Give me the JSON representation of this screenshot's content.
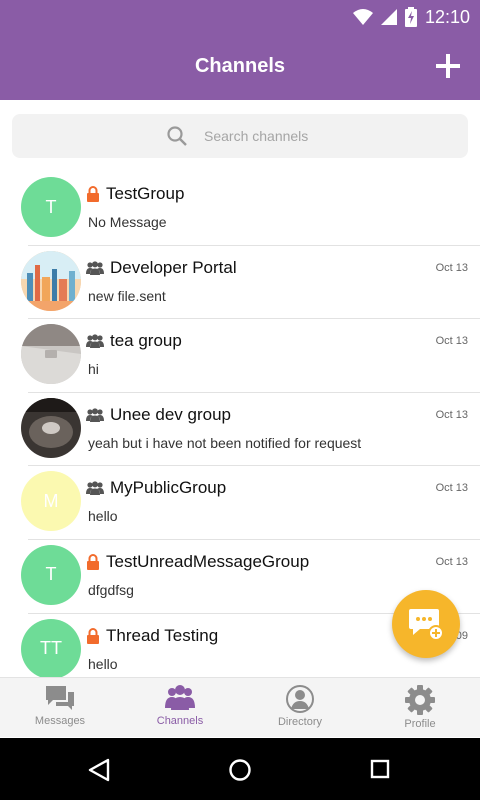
{
  "status_bar": {
    "time": "12:10"
  },
  "header": {
    "title": "Channels",
    "add_icon": "plus-icon"
  },
  "search": {
    "placeholder": "Search channels",
    "icon": "search-icon"
  },
  "colors": {
    "primary": "#8a5ca6",
    "avatar_green": "#6edc97",
    "avatar_yellow": "#fbf9b0",
    "lock_orange": "#f26b2c",
    "fab": "#f6b62b"
  },
  "channels": [
    {
      "avatar_text": "T",
      "avatar_type": "letter",
      "privacy": "private",
      "name": "TestGroup",
      "message": "No Message",
      "date": ""
    },
    {
      "avatar_text": "",
      "avatar_type": "photo-city",
      "privacy": "public",
      "name": "Developer Portal",
      "message": "new file.sent",
      "date": "Oct 13"
    },
    {
      "avatar_text": "",
      "avatar_type": "photo-desk",
      "privacy": "public",
      "name": "tea group",
      "message": "hi",
      "date": "Oct 13"
    },
    {
      "avatar_text": "",
      "avatar_type": "photo-dark",
      "privacy": "public",
      "name": "Unee dev group",
      "message": "yeah but i have not been notified for request",
      "date": "Oct 13"
    },
    {
      "avatar_text": "M",
      "avatar_type": "letter-yellow",
      "privacy": "public",
      "name": "MyPublicGroup",
      "message": "hello",
      "date": "Oct 13"
    },
    {
      "avatar_text": "T",
      "avatar_type": "letter",
      "privacy": "private",
      "name": "TestUnreadMessageGroup",
      "message": "dfgdfsg",
      "date": "Oct 13"
    },
    {
      "avatar_text": "TT",
      "avatar_type": "letter",
      "privacy": "private",
      "name": "Thread Testing",
      "message": "hello",
      "date": "Oct 09"
    }
  ],
  "tabs": [
    {
      "label": "Messages",
      "icon": "chat-bubbles-icon",
      "active": false
    },
    {
      "label": "Channels",
      "icon": "people-group-icon",
      "active": true
    },
    {
      "label": "Directory",
      "icon": "person-circle-icon",
      "active": false
    },
    {
      "label": "Profile",
      "icon": "gear-icon",
      "active": false
    }
  ],
  "fab": {
    "icon": "new-chat-icon"
  }
}
